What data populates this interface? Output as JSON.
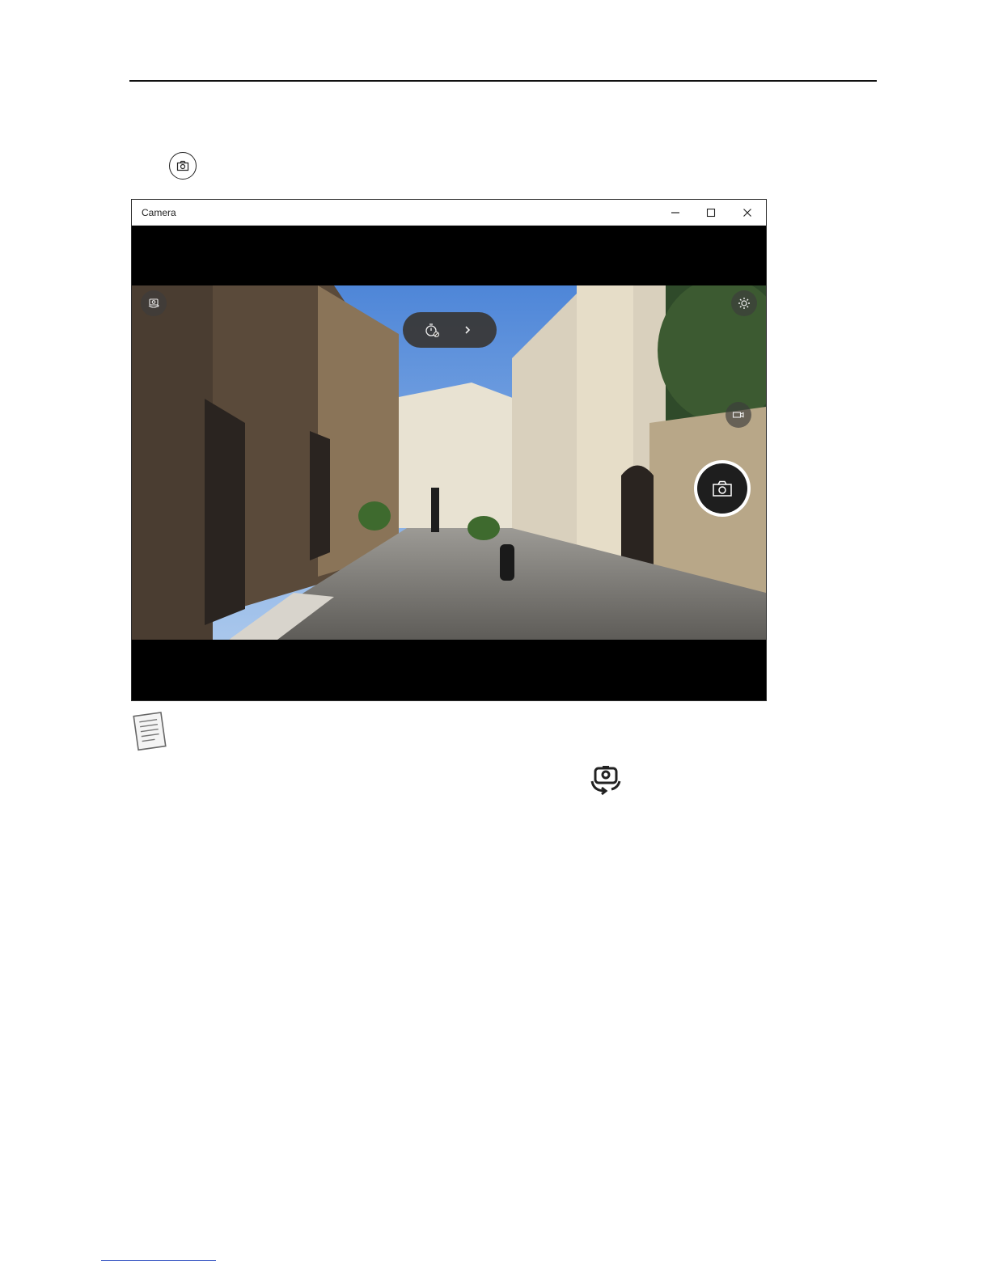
{
  "window": {
    "title": "Camera"
  },
  "titlebar_controls": {
    "minimize": "minimize-icon",
    "maximize": "maximize-icon",
    "close": "close-icon"
  },
  "camera_controls": {
    "switch_camera": "camera-switch-icon",
    "timer": "timer-off-icon",
    "expand": "chevron-right-icon",
    "settings": "gear-icon",
    "video_mode": "video-camera-icon",
    "take_photo": "camera-icon"
  },
  "colors": {
    "page_background": "#ffffff",
    "window_background": "#000000",
    "control_background": "#3c3c3c",
    "shutter_ring": "#ffffff"
  }
}
